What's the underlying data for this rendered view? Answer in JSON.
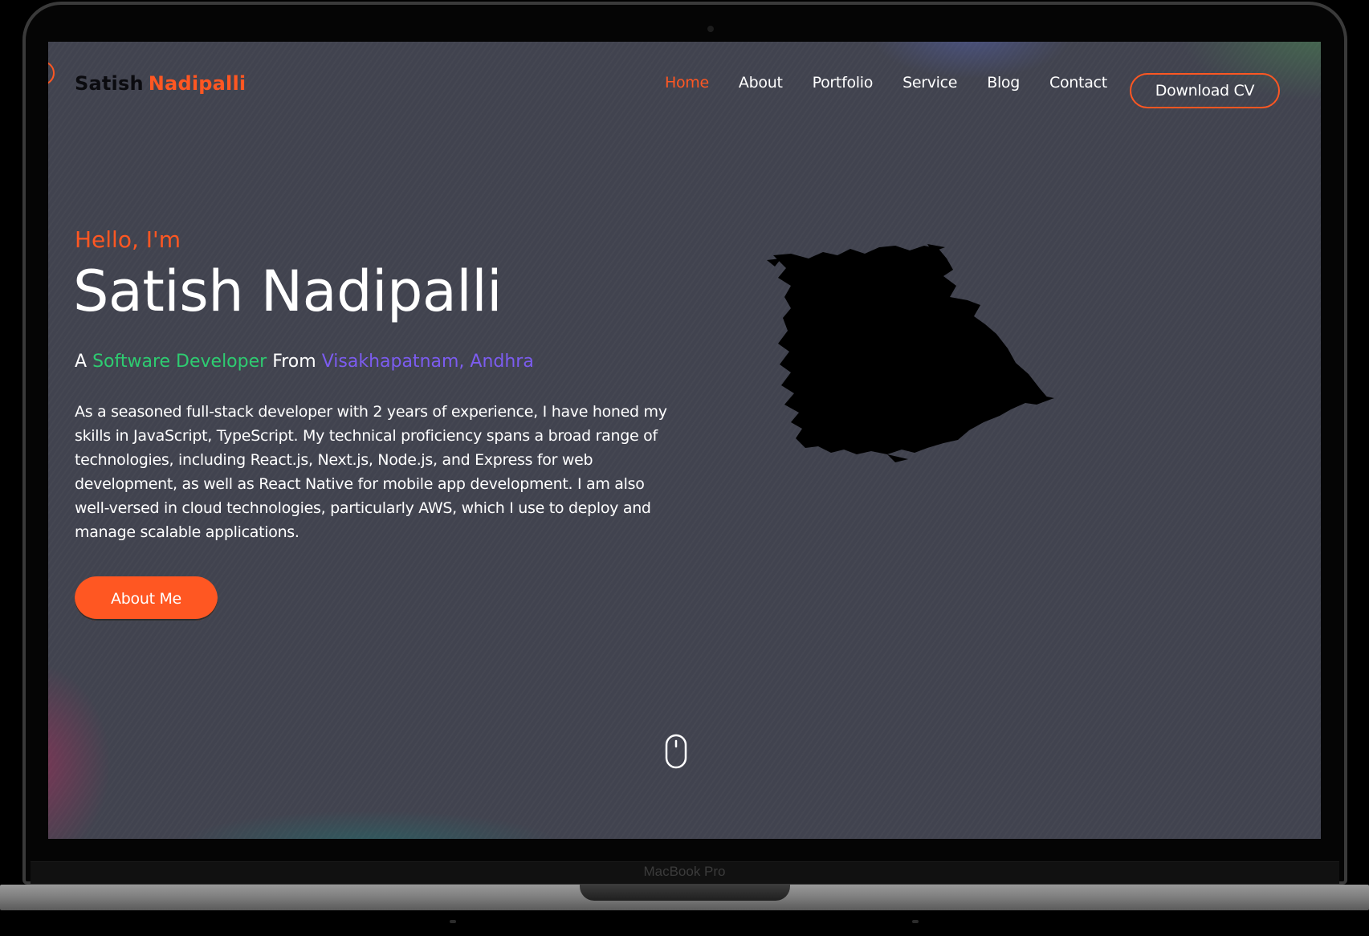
{
  "device": {
    "brand_label": "MacBook Pro"
  },
  "header": {
    "logo_first": "Satish",
    "logo_last": "Nadipalli",
    "nav": [
      {
        "label": "Home",
        "active": true
      },
      {
        "label": "About",
        "active": false
      },
      {
        "label": "Portfolio",
        "active": false
      },
      {
        "label": "Service",
        "active": false
      },
      {
        "label": "Blog",
        "active": false
      },
      {
        "label": "Contact",
        "active": false
      }
    ],
    "cta_label": "Download CV"
  },
  "hero": {
    "greeting": "Hello, I'm",
    "name": "Satish Nadipalli",
    "tagline_prefix": "A",
    "tagline_role": "Software Developer",
    "tagline_mid": "From",
    "tagline_place": "Visakhapatnam, Andhra",
    "intro": "As a seasoned full-stack developer with 2 years of experience, I have honed my skills in JavaScript, TypeScript. My technical proficiency spans a broad range of technologies, including React.js, Next.js, Node.js, and Express for web development, as well as React Native for mobile app development. I am also well-versed in cloud technologies, particularly AWS, which I use to deploy and manage scalable applications.",
    "button_label": "About Me"
  },
  "icons": {
    "scroll": "mouse-scroll-icon",
    "hero_image": "brush-stroke-image"
  },
  "colors": {
    "accent": "#ff5722",
    "role": "#2ecc71",
    "place": "#7c5cf0",
    "background": "#41434f"
  }
}
